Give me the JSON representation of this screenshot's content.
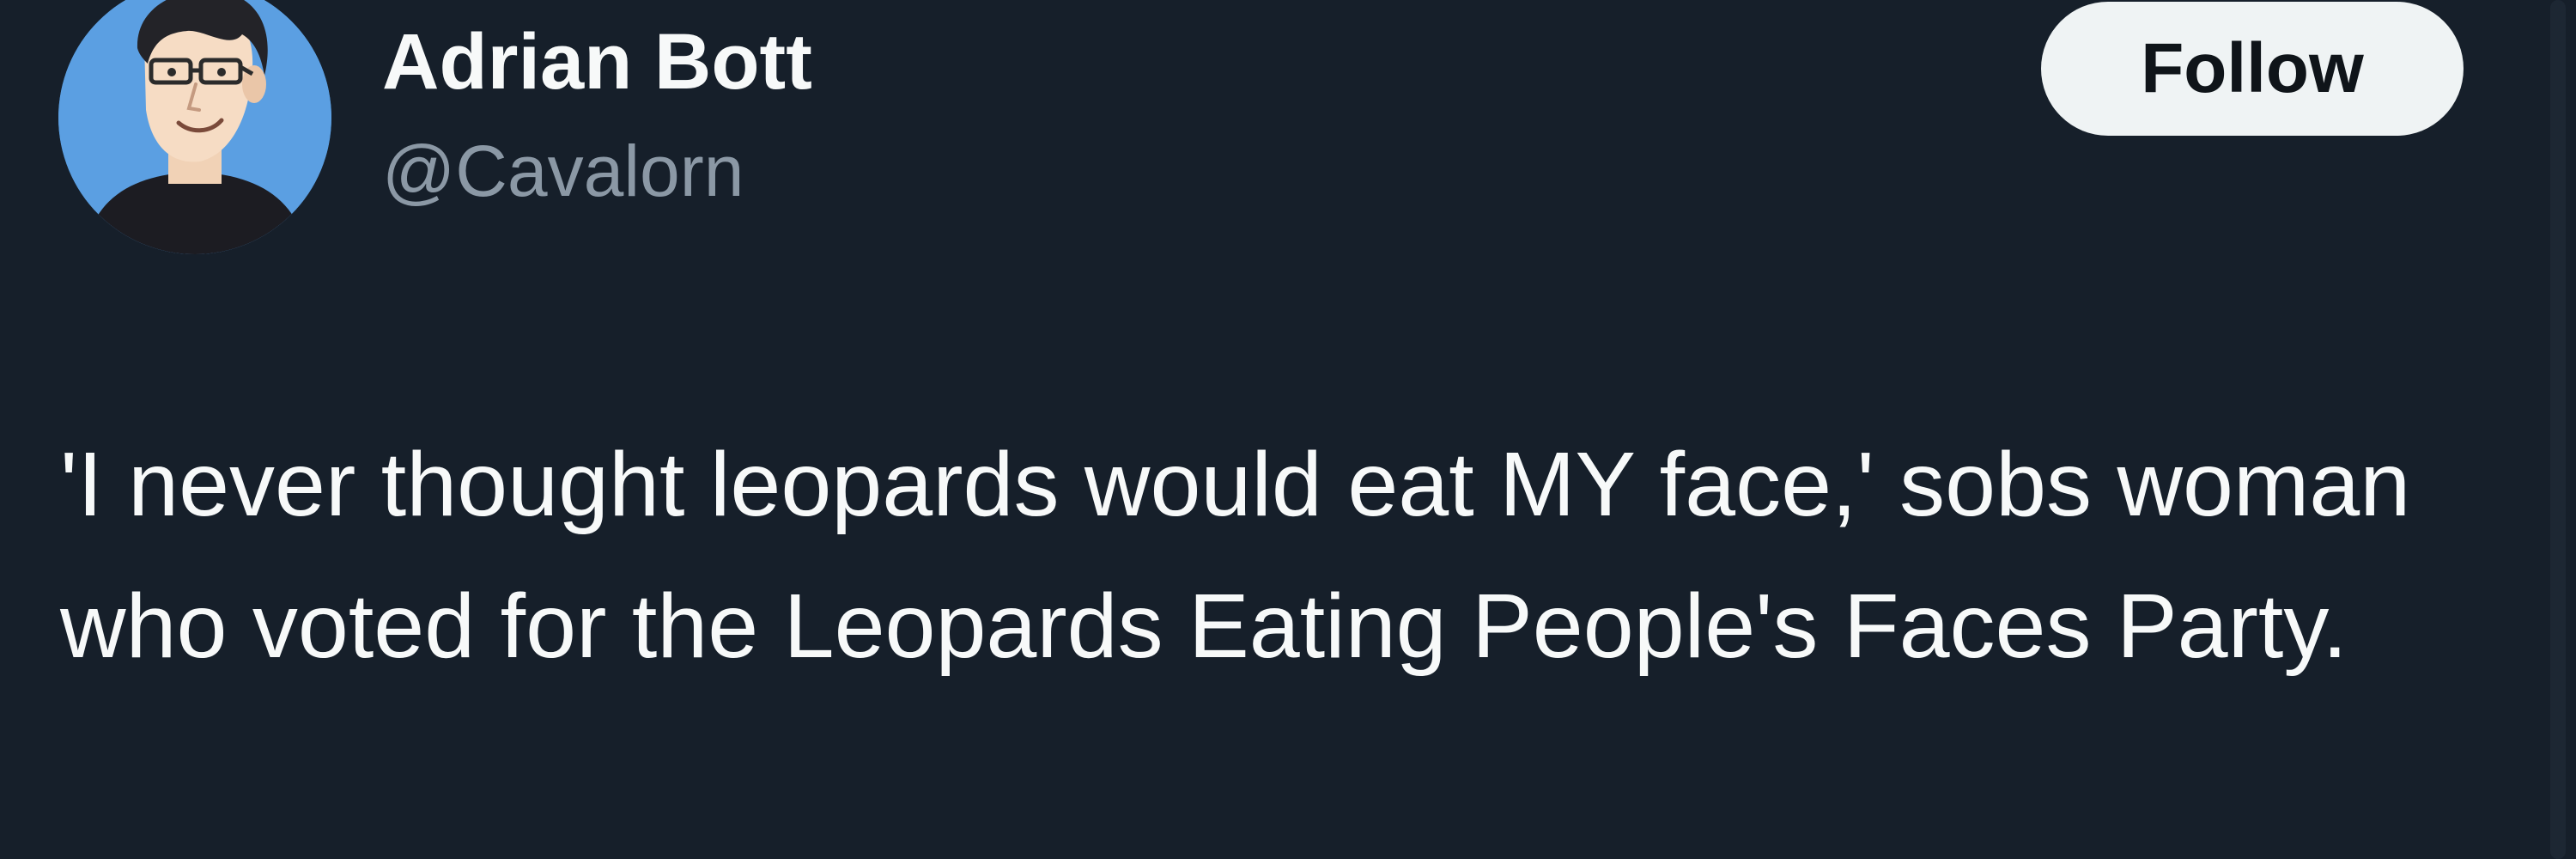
{
  "author": {
    "display_name": "Adrian Bott",
    "handle": "@Cavalorn",
    "avatar_icon": "cartoon-man-avatar-icon"
  },
  "follow_button": {
    "label": "Follow"
  },
  "tweet": {
    "text": "'I never thought leopards would eat MY face,' sobs woman who voted for the Leopards Eating People's Faces Party."
  },
  "colors": {
    "background": "#16202a",
    "text_primary": "#f7f9f9",
    "text_secondary": "#8b98a5",
    "button_bg": "#eff3f4",
    "button_text": "#0f1419",
    "avatar_bg": "#5b9fe2"
  }
}
